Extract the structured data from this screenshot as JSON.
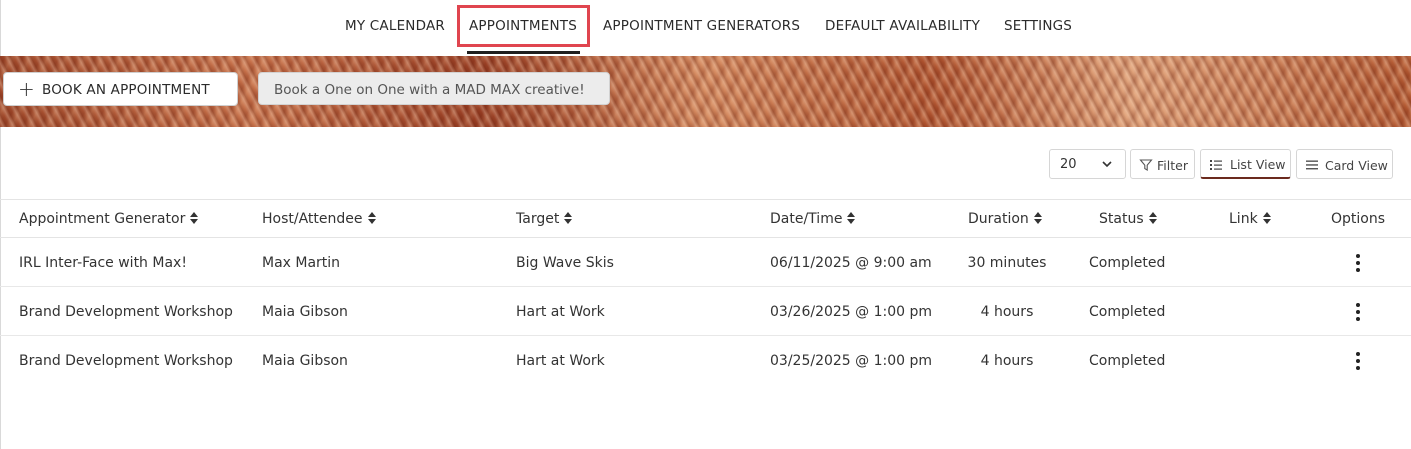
{
  "nav": {
    "tabs": [
      {
        "label": "MY CALENDAR"
      },
      {
        "label": "APPOINTMENTS",
        "active": true
      },
      {
        "label": "APPOINTMENT GENERATORS"
      },
      {
        "label": "DEFAULT AVAILABILITY"
      },
      {
        "label": "SETTINGS"
      }
    ]
  },
  "banner": {
    "book_button_label": "BOOK AN APPOINTMENT",
    "book_button_icon": "plus-icon",
    "promo_button_label": "Book a One on One with a MAD MAX creative!"
  },
  "toolbar": {
    "page_size": "20",
    "filter_label": "Filter",
    "list_view_label": "List View",
    "card_view_label": "Card View",
    "active_view": "list",
    "accent_color": "#6b2a1e"
  },
  "table": {
    "columns": [
      "Appointment Generator",
      "Host/Attendee",
      "Target",
      "Date/Time",
      "Duration",
      "Status",
      "Link",
      "Options"
    ],
    "rows": [
      {
        "generator": "IRL Inter-Face with Max!",
        "host": "Max Martin",
        "target": "Big Wave Skis",
        "datetime": "06/11/2025 @ 9:00 am",
        "duration": "30 minutes",
        "status": "Completed",
        "link": ""
      },
      {
        "generator": "Brand Development Workshop",
        "host": "Maia Gibson",
        "target": "Hart at Work",
        "datetime": "03/26/2025 @ 1:00 pm",
        "duration": "4 hours",
        "status": "Completed",
        "link": ""
      },
      {
        "generator": "Brand Development Workshop",
        "host": "Maia Gibson",
        "target": "Hart at Work",
        "datetime": "03/25/2025 @ 1:00 pm",
        "duration": "4 hours",
        "status": "Completed",
        "link": ""
      }
    ]
  },
  "colors": {
    "highlight_box": "#e0454f",
    "active_underline": "#1f1f1f"
  }
}
